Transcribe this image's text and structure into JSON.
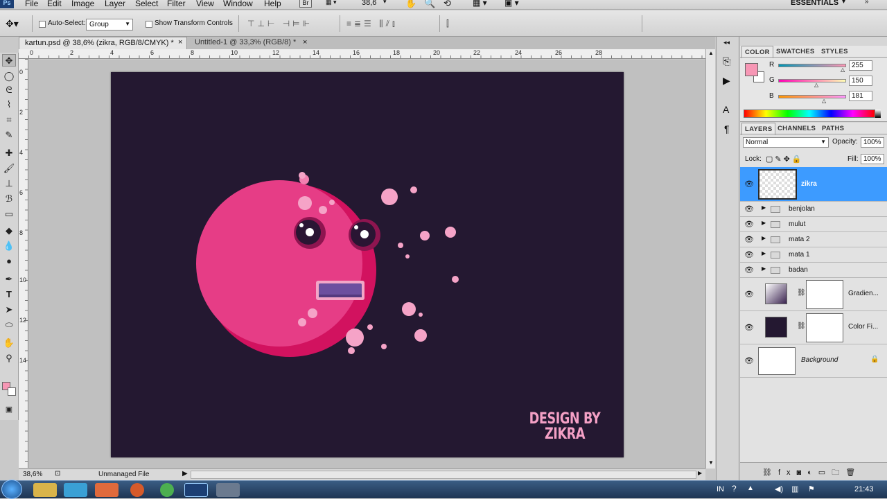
{
  "menu": {
    "items": [
      "File",
      "Edit",
      "Image",
      "Layer",
      "Select",
      "Filter",
      "View",
      "Window",
      "Help"
    ],
    "br": "Br",
    "zoom": "38,6",
    "workspace": "ESSENTIALS"
  },
  "options": {
    "auto_select_label": "Auto-Select:",
    "auto_select_value": "Group",
    "transform_label": "Show Transform Controls"
  },
  "tabs": [
    {
      "label": "kartun.psd @ 38,6% (zikra, RGB/8/CMYK) *"
    },
    {
      "label": "Untitled-1 @ 33,3% (RGB/8) *"
    }
  ],
  "ruler_top": [
    "0",
    "2",
    "4",
    "6",
    "8",
    "10",
    "12",
    "14",
    "16",
    "18",
    "20",
    "22",
    "24",
    "26",
    "28"
  ],
  "ruler_left": [
    "0",
    "2",
    "4",
    "6",
    "8",
    "10",
    "12",
    "14"
  ],
  "status": {
    "zoom": "38,6%",
    "file": "Unmanaged File"
  },
  "canvas": {
    "credit_line1": "DESIGN BY",
    "credit_line2": "ZIKRA"
  },
  "color_panel": {
    "tabs": [
      "COLOR",
      "SWATCHES",
      "STYLES"
    ],
    "r_label": "R",
    "g_label": "G",
    "b_label": "B",
    "r": "255",
    "g": "150",
    "b": "181",
    "foreground": "#f797b5",
    "background": "#ffffff"
  },
  "layers_panel": {
    "tabs": [
      "LAYERS",
      "CHANNELS",
      "PATHS"
    ],
    "blend_mode": "Normal",
    "opacity_label": "Opacity:",
    "opacity": "100%",
    "lock_label": "Lock:",
    "fill_label": "Fill:",
    "fill": "100%",
    "layers": [
      {
        "name": "zikra",
        "kind": "pixel",
        "selected": true
      },
      {
        "name": "benjolan",
        "kind": "group"
      },
      {
        "name": "mulut",
        "kind": "group"
      },
      {
        "name": "mata 2",
        "kind": "group"
      },
      {
        "name": "mata 1",
        "kind": "group"
      },
      {
        "name": "badan",
        "kind": "group"
      },
      {
        "name": "Gradien...",
        "kind": "gradient-fill"
      },
      {
        "name": "Color Fi...",
        "kind": "color-fill"
      },
      {
        "name": "Background",
        "kind": "background",
        "locked": true
      }
    ]
  },
  "taskbar": {
    "lang": "IN",
    "clock": "21:43"
  }
}
